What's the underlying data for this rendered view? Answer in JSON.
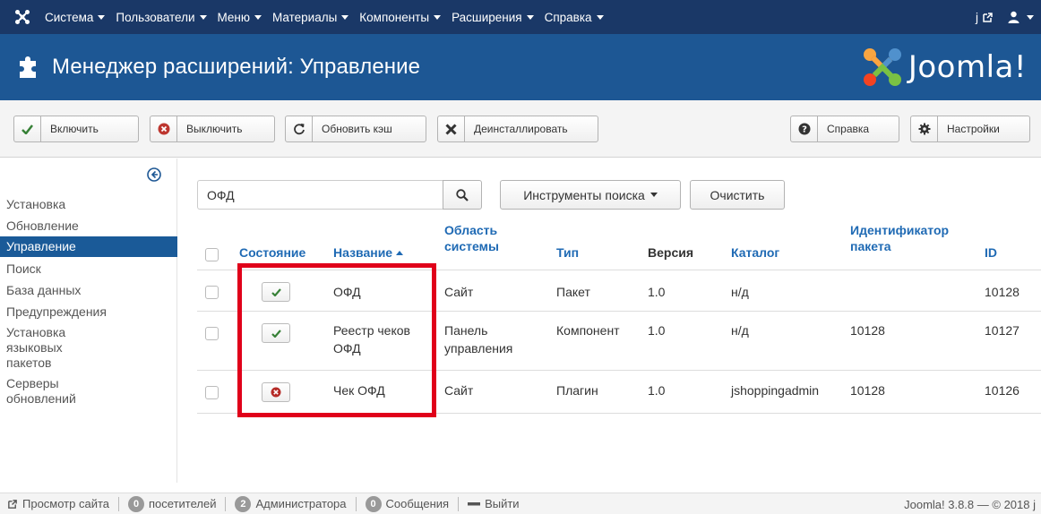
{
  "topbar": {
    "menu": [
      "Система",
      "Пользователи",
      "Меню",
      "Материалы",
      "Компоненты",
      "Расширения",
      "Справка"
    ],
    "right_link": "j"
  },
  "header": {
    "title": "Менеджер расширений: Управление",
    "brand": "Joomla!"
  },
  "toolbar": {
    "enable": "Включить",
    "disable": "Выключить",
    "refresh_cache": "Обновить кэш",
    "uninstall": "Деинсталлировать",
    "help": "Справка",
    "options": "Настройки"
  },
  "sidebar": {
    "items": [
      {
        "label": "Установка",
        "active": false
      },
      {
        "label": "Обновление",
        "active": false
      },
      {
        "label": "Управление",
        "active": true
      },
      {
        "label": "Поиск",
        "active": false
      },
      {
        "label": "База данных",
        "active": false
      },
      {
        "label": "Предупреждения",
        "active": false
      },
      {
        "label": "Установка языковых пакетов",
        "active": false
      },
      {
        "label": "Серверы обновлений",
        "active": false
      }
    ]
  },
  "search": {
    "value": "ОФД",
    "tools_label": "Инструменты поиска",
    "clear_label": "Очистить"
  },
  "table": {
    "headers": {
      "state": "Состояние",
      "name": "Название",
      "area_line1": "Область",
      "area_line2": "системы",
      "type": "Тип",
      "version": "Версия",
      "folder": "Каталог",
      "package_line1": "Идентификатор",
      "package_line2": "пакета",
      "id": "ID"
    },
    "rows": [
      {
        "enabled": true,
        "name1": "ОФД",
        "name2": "",
        "area1": "Сайт",
        "area2": "",
        "type": "Пакет",
        "version": "1.0",
        "folder": "н/д",
        "package": "",
        "id": "10128"
      },
      {
        "enabled": true,
        "name1": "Реестр чеков",
        "name2": "ОФД",
        "area1": "Панель",
        "area2": "управления",
        "type": "Компонент",
        "version": "1.0",
        "folder": "н/д",
        "package": "10128",
        "id": "10127"
      },
      {
        "enabled": false,
        "name1": "Чек ОФД",
        "name2": "",
        "area1": "Сайт",
        "area2": "",
        "type": "Плагин",
        "version": "1.0",
        "folder": "jshoppingadmin",
        "package": "10128",
        "id": "10126"
      }
    ]
  },
  "statusbar": {
    "view_site": "Просмотр сайта",
    "visitors_count": "0",
    "visitors_label": "посетителей",
    "admins_count": "2",
    "admins_label": "Администратора",
    "messages_count": "0",
    "messages_label": "Сообщения",
    "logout": "Выйти",
    "version": "Joomla! 3.8.8 — © 2018 j"
  },
  "colors": {
    "navbar": "#1a3867",
    "header": "#1d5794",
    "link": "#1f6ab4",
    "highlight": "#e0001a",
    "enabled": "#3b8a3b",
    "disabled": "#b52b27"
  }
}
